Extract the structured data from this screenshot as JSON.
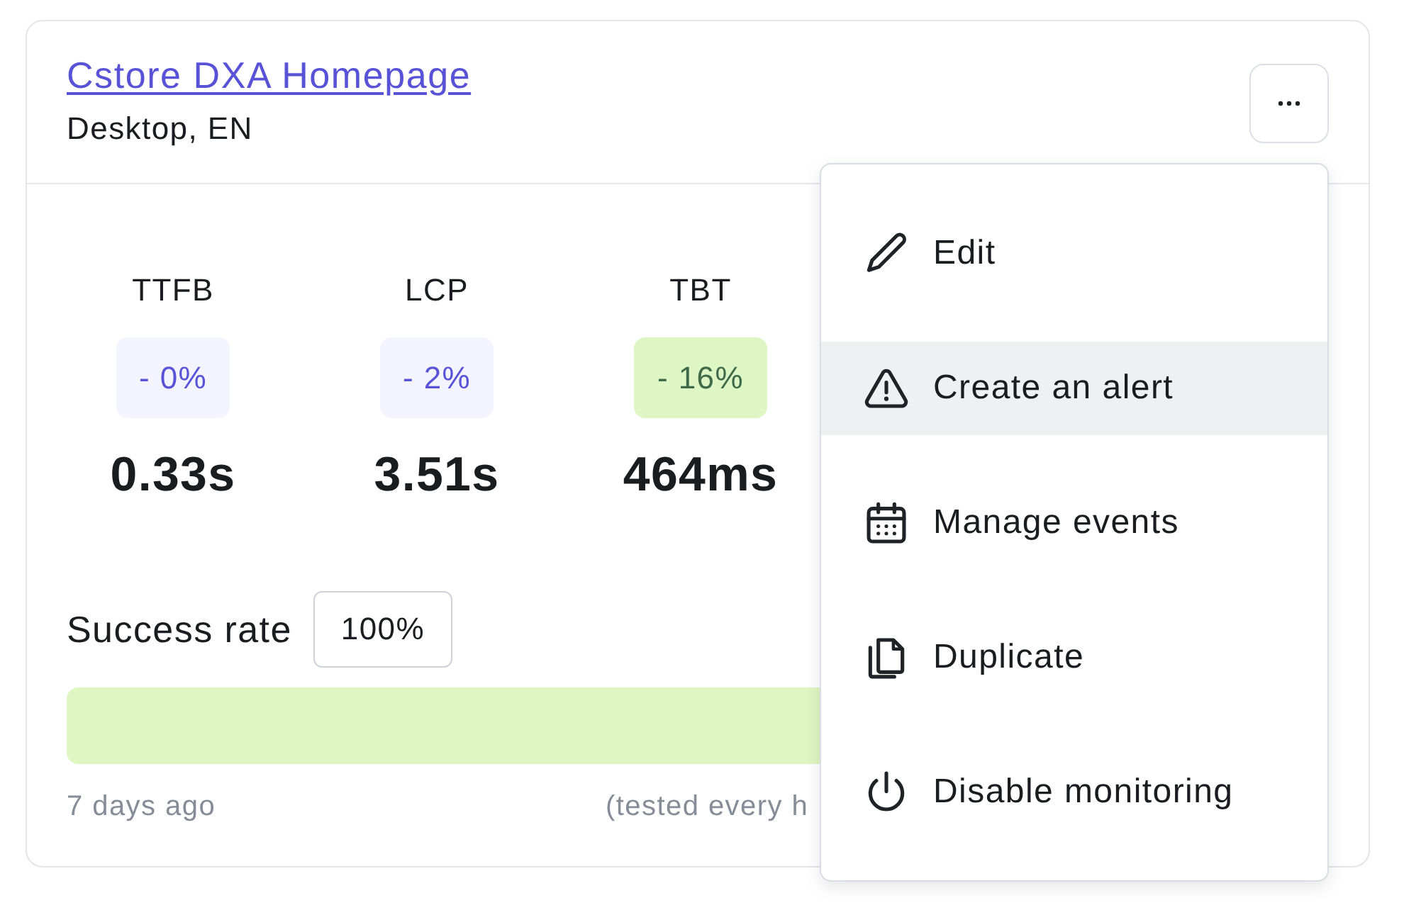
{
  "card": {
    "title": "Cstore DXA Homepage",
    "subtitle": "Desktop, EN"
  },
  "metrics": [
    {
      "label": "TTFB",
      "change": "- 0%",
      "kind": "neutral",
      "value": "0.33s"
    },
    {
      "label": "LCP",
      "change": "- 2%",
      "kind": "neutral",
      "value": "3.51s"
    },
    {
      "label": "TBT",
      "change": "- 16%",
      "kind": "good",
      "value": "464ms"
    }
  ],
  "success_rate": {
    "label": "Success rate",
    "value": "100%",
    "level": 1
  },
  "footer": {
    "last_run": "7 days ago",
    "schedule": "(tested every h"
  },
  "menu": {
    "items": [
      {
        "label": "Edit",
        "selected": false
      },
      {
        "label": "Create an alert",
        "selected": true
      },
      {
        "label": "Manage events",
        "selected": false
      },
      {
        "label": "Duplicate",
        "selected": false
      },
      {
        "label": "Disable monitoring",
        "selected": false
      }
    ]
  }
}
